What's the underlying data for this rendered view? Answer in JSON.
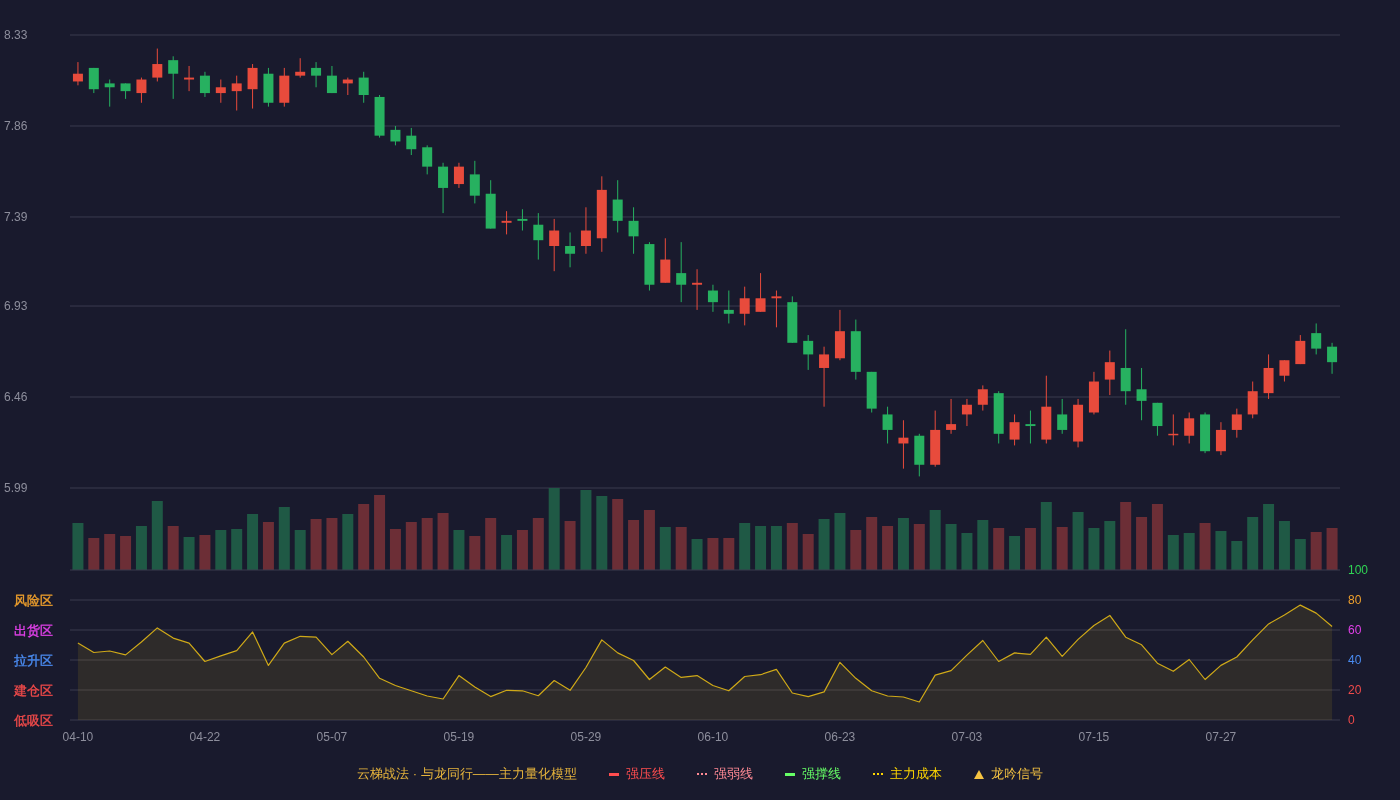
{
  "price_panel": {
    "chart_data": {
      "type": "candlestick",
      "grid": true,
      "categories": [
        null,
        null,
        null,
        null,
        null,
        null,
        null,
        null,
        null,
        null,
        null,
        null,
        null,
        null,
        null,
        null,
        null,
        null,
        null,
        null,
        null,
        null,
        null,
        null,
        null,
        null,
        null,
        null,
        null,
        null,
        null,
        null,
        null,
        null,
        null,
        null,
        null,
        null,
        null,
        null,
        null,
        null,
        null,
        null,
        null,
        null,
        null,
        null,
        null,
        null,
        null,
        null,
        null,
        null,
        null,
        null,
        null,
        null,
        null,
        null,
        null,
        null,
        null,
        null,
        null,
        null,
        null,
        null,
        null,
        null,
        null,
        null,
        null,
        null,
        null,
        null,
        null,
        null,
        null,
        null
      ],
      "ylim": [
        5.99,
        8.33
      ],
      "yticks": [
        5.99,
        6.46,
        6.93,
        7.39,
        7.86,
        8.33
      ],
      "ohlc": [
        [
          8.09,
          8.19,
          8.07,
          8.13
        ],
        [
          8.16,
          8.16,
          8.03,
          8.05
        ],
        [
          8.08,
          8.1,
          7.96,
          8.06
        ],
        [
          8.08,
          8.08,
          8.0,
          8.04
        ],
        [
          8.03,
          8.11,
          7.98,
          8.1
        ],
        [
          8.11,
          8.26,
          8.09,
          8.18
        ],
        [
          8.2,
          8.22,
          8.0,
          8.13
        ],
        [
          8.1,
          8.17,
          8.04,
          8.11
        ],
        [
          8.12,
          8.14,
          8.01,
          8.03
        ],
        [
          8.03,
          8.1,
          7.98,
          8.06
        ],
        [
          8.04,
          8.12,
          7.94,
          8.08
        ],
        [
          8.05,
          8.18,
          7.95,
          8.16
        ],
        [
          8.13,
          8.16,
          7.96,
          7.98
        ],
        [
          7.98,
          8.16,
          7.96,
          8.12
        ],
        [
          8.12,
          8.21,
          8.11,
          8.14
        ],
        [
          8.16,
          8.19,
          8.06,
          8.12
        ],
        [
          8.12,
          8.17,
          8.03,
          8.03
        ],
        [
          8.08,
          8.11,
          8.02,
          8.1
        ],
        [
          8.11,
          8.14,
          7.98,
          8.02
        ],
        [
          8.01,
          8.02,
          7.8,
          7.81
        ],
        [
          7.84,
          7.86,
          7.76,
          7.78
        ],
        [
          7.81,
          7.85,
          7.71,
          7.74
        ],
        [
          7.75,
          7.76,
          7.61,
          7.65
        ],
        [
          7.65,
          7.67,
          7.41,
          7.54
        ],
        [
          7.56,
          7.67,
          7.54,
          7.65
        ],
        [
          7.61,
          7.68,
          7.46,
          7.5
        ],
        [
          7.51,
          7.58,
          7.33,
          7.33
        ],
        [
          7.36,
          7.42,
          7.3,
          7.37
        ],
        [
          7.38,
          7.43,
          7.32,
          7.37
        ],
        [
          7.35,
          7.41,
          7.17,
          7.27
        ],
        [
          7.24,
          7.38,
          7.11,
          7.32
        ],
        [
          7.24,
          7.31,
          7.13,
          7.2
        ],
        [
          7.24,
          7.44,
          7.2,
          7.32
        ],
        [
          7.28,
          7.6,
          7.21,
          7.53
        ],
        [
          7.48,
          7.58,
          7.31,
          7.37
        ],
        [
          7.37,
          7.44,
          7.2,
          7.29
        ],
        [
          7.25,
          7.26,
          7.01,
          7.04
        ],
        [
          7.05,
          7.28,
          7.05,
          7.17
        ],
        [
          7.1,
          7.26,
          6.95,
          7.04
        ],
        [
          7.04,
          7.12,
          6.91,
          7.05
        ],
        [
          7.01,
          7.04,
          6.9,
          6.95
        ],
        [
          6.91,
          7.01,
          6.84,
          6.89
        ],
        [
          6.89,
          7.03,
          6.83,
          6.97
        ],
        [
          6.9,
          7.1,
          6.9,
          6.97
        ],
        [
          6.97,
          7.01,
          6.82,
          6.98
        ],
        [
          6.95,
          6.98,
          6.74,
          6.74
        ],
        [
          6.75,
          6.78,
          6.6,
          6.68
        ],
        [
          6.61,
          6.72,
          6.41,
          6.68
        ],
        [
          6.66,
          6.91,
          6.65,
          6.8
        ],
        [
          6.8,
          6.86,
          6.55,
          6.59
        ],
        [
          6.59,
          6.59,
          6.38,
          6.4
        ],
        [
          6.37,
          6.41,
          6.22,
          6.29
        ],
        [
          6.22,
          6.34,
          6.09,
          6.25
        ],
        [
          6.26,
          6.27,
          6.05,
          6.11
        ],
        [
          6.11,
          6.39,
          6.1,
          6.29
        ],
        [
          6.29,
          6.45,
          6.27,
          6.32
        ],
        [
          6.37,
          6.45,
          6.31,
          6.42
        ],
        [
          6.42,
          6.52,
          6.39,
          6.5
        ],
        [
          6.48,
          6.49,
          6.22,
          6.27
        ],
        [
          6.24,
          6.37,
          6.21,
          6.33
        ],
        [
          6.32,
          6.39,
          6.22,
          6.31
        ],
        [
          6.24,
          6.57,
          6.22,
          6.41
        ],
        [
          6.37,
          6.45,
          6.27,
          6.29
        ],
        [
          6.23,
          6.45,
          6.2,
          6.42
        ],
        [
          6.38,
          6.59,
          6.37,
          6.54
        ],
        [
          6.55,
          6.7,
          6.47,
          6.64
        ],
        [
          6.61,
          6.81,
          6.42,
          6.49
        ],
        [
          6.5,
          6.61,
          6.34,
          6.44
        ],
        [
          6.43,
          6.43,
          6.26,
          6.31
        ],
        [
          6.27,
          6.37,
          6.21,
          6.27
        ],
        [
          6.26,
          6.38,
          6.22,
          6.35
        ],
        [
          6.37,
          6.38,
          6.17,
          6.18
        ],
        [
          6.18,
          6.33,
          6.16,
          6.29
        ],
        [
          6.29,
          6.4,
          6.25,
          6.37
        ],
        [
          6.37,
          6.54,
          6.35,
          6.49
        ],
        [
          6.48,
          6.68,
          6.45,
          6.61
        ],
        [
          6.57,
          6.65,
          6.54,
          6.65
        ],
        [
          6.63,
          6.78,
          6.63,
          6.75
        ],
        [
          6.79,
          6.84,
          6.68,
          6.71
        ],
        [
          6.72,
          6.74,
          6.58,
          6.64
        ]
      ]
    }
  },
  "indicator_panel": {
    "zones": [
      {
        "label": "风险区",
        "color": "#f0a02c"
      },
      {
        "label": "出货区",
        "color": "#e040e8"
      },
      {
        "label": "拉升区",
        "color": "#4a8cf2"
      },
      {
        "label": "建仓区",
        "color": "#f04a4a"
      },
      {
        "label": "低吸区",
        "color": "#f04a4a"
      }
    ],
    "chart_data": {
      "type": "area",
      "grid": true,
      "categories": [
        "04-10",
        null,
        null,
        null,
        null,
        null,
        null,
        null,
        "04-22",
        null,
        null,
        null,
        null,
        null,
        null,
        null,
        "05-07",
        null,
        null,
        null,
        null,
        null,
        null,
        null,
        "05-19",
        null,
        null,
        null,
        null,
        null,
        null,
        null,
        "05-29",
        null,
        null,
        null,
        null,
        null,
        null,
        null,
        "06-10",
        null,
        null,
        null,
        null,
        null,
        null,
        null,
        "06-23",
        null,
        null,
        null,
        null,
        null,
        null,
        null,
        "07-03",
        null,
        null,
        null,
        null,
        null,
        null,
        null,
        "07-15",
        null,
        null,
        null,
        null,
        null,
        null,
        null,
        "07-27",
        null,
        null,
        null,
        null,
        null,
        null,
        null
      ],
      "ylim": [
        0,
        100
      ],
      "yticks": [
        0,
        20,
        40,
        60,
        80,
        100
      ],
      "series": [
        {
          "color": "#cfa918",
          "values": [
            51.3,
            45,
            46,
            43.4,
            52,
            61.4,
            54.6,
            51.3,
            39,
            42.7,
            46.3,
            58.7,
            36.4,
            51.3,
            55.8,
            55.2,
            43.6,
            52.5,
            42,
            27.8,
            23,
            19.5,
            16,
            14,
            29.6,
            22,
            15.6,
            19.8,
            19.5,
            16.2,
            26.3,
            19.8,
            35,
            53.4,
            44.7,
            39.7,
            27,
            35.3,
            28.4,
            29.6,
            23,
            19.5,
            29,
            30.2,
            33.7,
            18,
            15.6,
            18.7,
            38.5,
            27.8,
            19.5,
            16,
            15.3,
            12,
            29.9,
            32.9,
            43.3,
            53,
            39,
            44.7,
            43.8,
            55.2,
            42.4,
            53.7,
            63,
            69.7,
            55.2,
            50.1,
            37.9,
            32.5,
            40.3,
            27,
            36.4,
            42,
            53.4,
            64.1,
            70,
            76.6,
            71.3,
            62.3
          ]
        }
      ]
    }
  },
  "legend": {
    "title": "云梯战法 · 与龙同行——主力量化模型",
    "items": [
      {
        "label": "强压线",
        "kind": "solid",
        "color": "#ff4d4f"
      },
      {
        "label": "强弱线",
        "kind": "dashed",
        "color": "#ff8a94"
      },
      {
        "label": "强撑线",
        "kind": "solid",
        "color": "#66ff66"
      },
      {
        "label": "主力成本",
        "kind": "dashed",
        "color": "#ffd700"
      },
      {
        "label": "龙吟信号",
        "kind": "triangle",
        "color": "#f5c342"
      }
    ]
  }
}
